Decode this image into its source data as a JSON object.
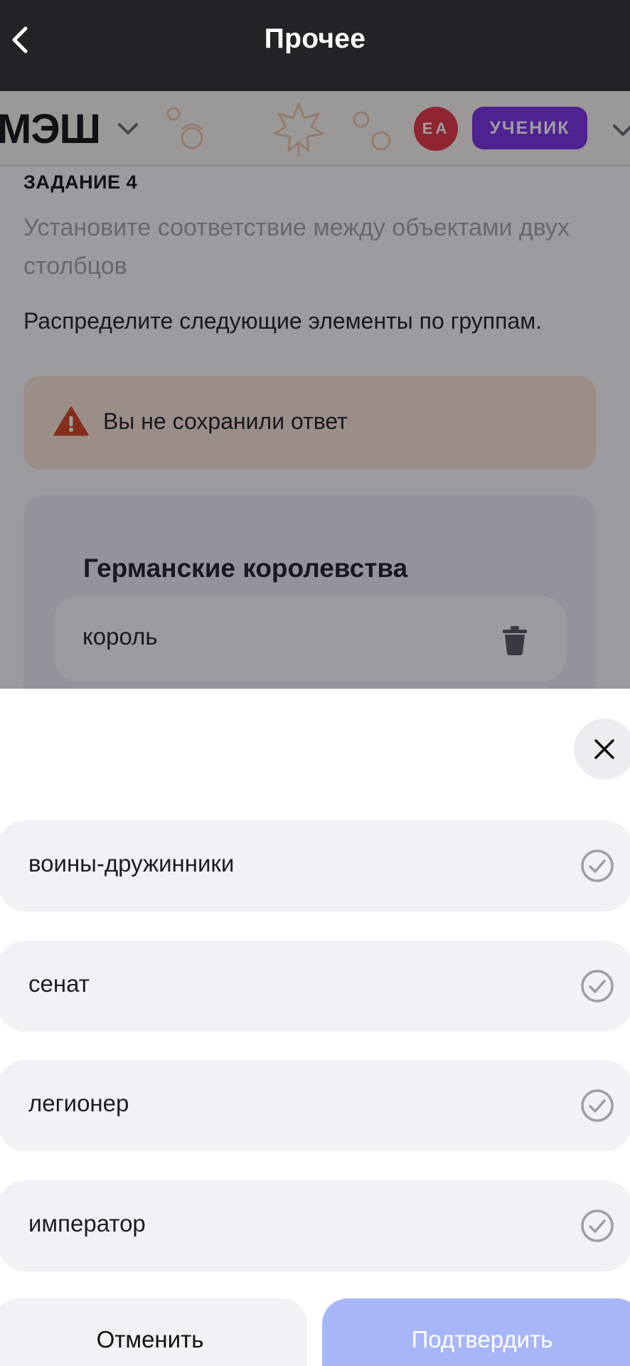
{
  "navbar": {
    "title": "Прочее",
    "back_icon": "chevron-left-icon"
  },
  "site_header": {
    "logo": "МЭШ",
    "avatar_initials": "ЕА",
    "role": "УЧЕНИК"
  },
  "task": {
    "label": "ЗАДАНИЕ 4",
    "instruction": "Установите соответствие между объектами двух столбцов",
    "question": "Распределите следующие элементы по группам.",
    "warning": "Вы не сохранили ответ",
    "group": {
      "title": "Германские королевства",
      "items": [
        "король"
      ]
    }
  },
  "sheet": {
    "options": [
      {
        "label": "воины-дружинники"
      },
      {
        "label": "сенат"
      },
      {
        "label": "легионер"
      },
      {
        "label": "император"
      }
    ],
    "cancel_label": "Отменить",
    "confirm_label": "Подтвердить"
  },
  "colors": {
    "navbar_bg": "#232227",
    "avatar": "#e8333f",
    "role_badge": "#7a2ee6",
    "warning_bg": "#fde7d6",
    "warning_icon": "#d4441c",
    "option_bg": "#f1f1f6",
    "confirm_button": "#a7b6f8"
  }
}
